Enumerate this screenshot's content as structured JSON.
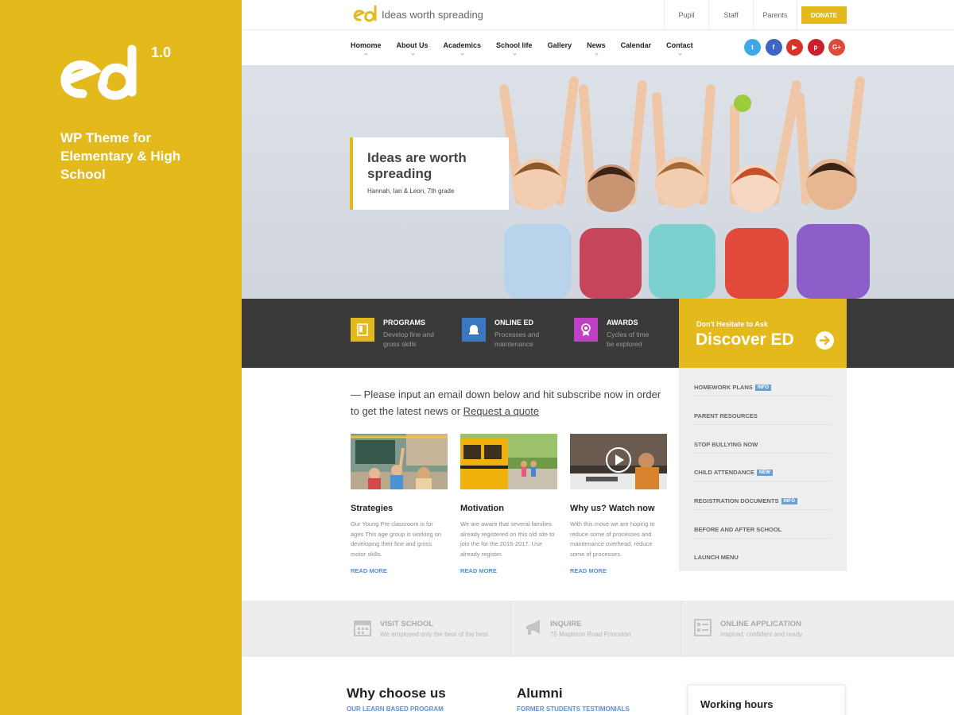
{
  "promo": {
    "version": "1.0",
    "tagline": "WP Theme for Elementary & High School"
  },
  "topbar": {
    "brand_text": "Ideas worth spreading",
    "links": [
      "Pupil",
      "Staff",
      "Parents"
    ],
    "donate_label": "DONATE"
  },
  "nav": {
    "items": [
      "Homome",
      "About Us",
      "Academics",
      "School life",
      "Gallery",
      "News",
      "Calendar",
      "Contact"
    ]
  },
  "socials": [
    {
      "icon": "twitter-icon",
      "glyph": "t",
      "color": "#3fa9e8"
    },
    {
      "icon": "facebook-icon",
      "glyph": "f",
      "color": "#3b66c4"
    },
    {
      "icon": "youtube-icon",
      "glyph": "▶",
      "color": "#d8352a"
    },
    {
      "icon": "pinterest-icon",
      "glyph": "p",
      "color": "#cc1f2d"
    },
    {
      "icon": "google-plus-icon",
      "glyph": "G+",
      "color": "#dd4b39"
    }
  ],
  "hero": {
    "title": "Ideas are worth spreading",
    "caption": "Hannah, Ian & Leon, 7th grade"
  },
  "features": [
    {
      "title": "PROGRAMS",
      "desc1": "Develop fine and",
      "desc2": "gross skills",
      "color": "#e4b91b",
      "icon": "book-icon"
    },
    {
      "title": "ONLINE ED",
      "desc1": "Processes and",
      "desc2": "maintenance",
      "color": "#3a78c2",
      "icon": "bell-icon"
    },
    {
      "title": "AWARDS",
      "desc1": "Cycles of time",
      "desc2": "be explored",
      "color": "#c03fc7",
      "icon": "award-icon"
    }
  ],
  "discover": {
    "small": "Don't Hesitate to Ask",
    "big": "Discover ED"
  },
  "side_menu": [
    {
      "label": "HOMEWORK PLANS",
      "badge": "INFO"
    },
    {
      "label": "PARENT RESOURCES",
      "badge": ""
    },
    {
      "label": "STOP BULLYING NOW",
      "badge": ""
    },
    {
      "label": "CHILD ATTENDANCE",
      "badge": "NEW"
    },
    {
      "label": "REGISTRATION DOCUMENTS",
      "badge": "INFO"
    },
    {
      "label": "BEFORE AND AFTER SCHOOL",
      "badge": ""
    },
    {
      "label": "LAUNCH MENU",
      "badge": ""
    }
  ],
  "intro": {
    "text": "— Please input an email down below and hit subscribe now in order to get the latest news or",
    "link": "Request a quote"
  },
  "cards": [
    {
      "title": "Strategies",
      "text": "Our Young Pre classroom is for ages This age group is working on developing their fine and gross motor skills.",
      "more": "READ MORE"
    },
    {
      "title": "Motivation",
      "text": "We are aware that several families already registered on this old site to join the for the 2016-2017. Use already register.",
      "more": "READ MORE"
    },
    {
      "title": "Why us? Watch now",
      "text": "With this move we are hoping to reduce some of processes and maintenance overhead, reduce some of processes.",
      "more": "READ MORE"
    }
  ],
  "strip": [
    {
      "title": "VISIT SCHOOL",
      "desc": "We employed only the best of the best",
      "icon": "calendar-icon"
    },
    {
      "title": "INQUIRE",
      "desc": "75 Mapleton Road Princeton",
      "icon": "megaphone-icon"
    },
    {
      "title": "ONLINE APPLICATION",
      "desc": "Inspired, confident and ready.",
      "icon": "form-icon"
    }
  ],
  "bottom": {
    "why_title": "Why choose us",
    "why_sub": "OUR LEARN BASED PROGRAM",
    "alumni_title": "Alumni",
    "alumni_sub": "FORMER STUDENTS TESTIMONIALS",
    "hours_title": "Working hours"
  },
  "colors": {
    "brand_yellow": "#e4b91b",
    "dark_band": "#3a3a3a",
    "link_blue": "#5b8fd6"
  }
}
